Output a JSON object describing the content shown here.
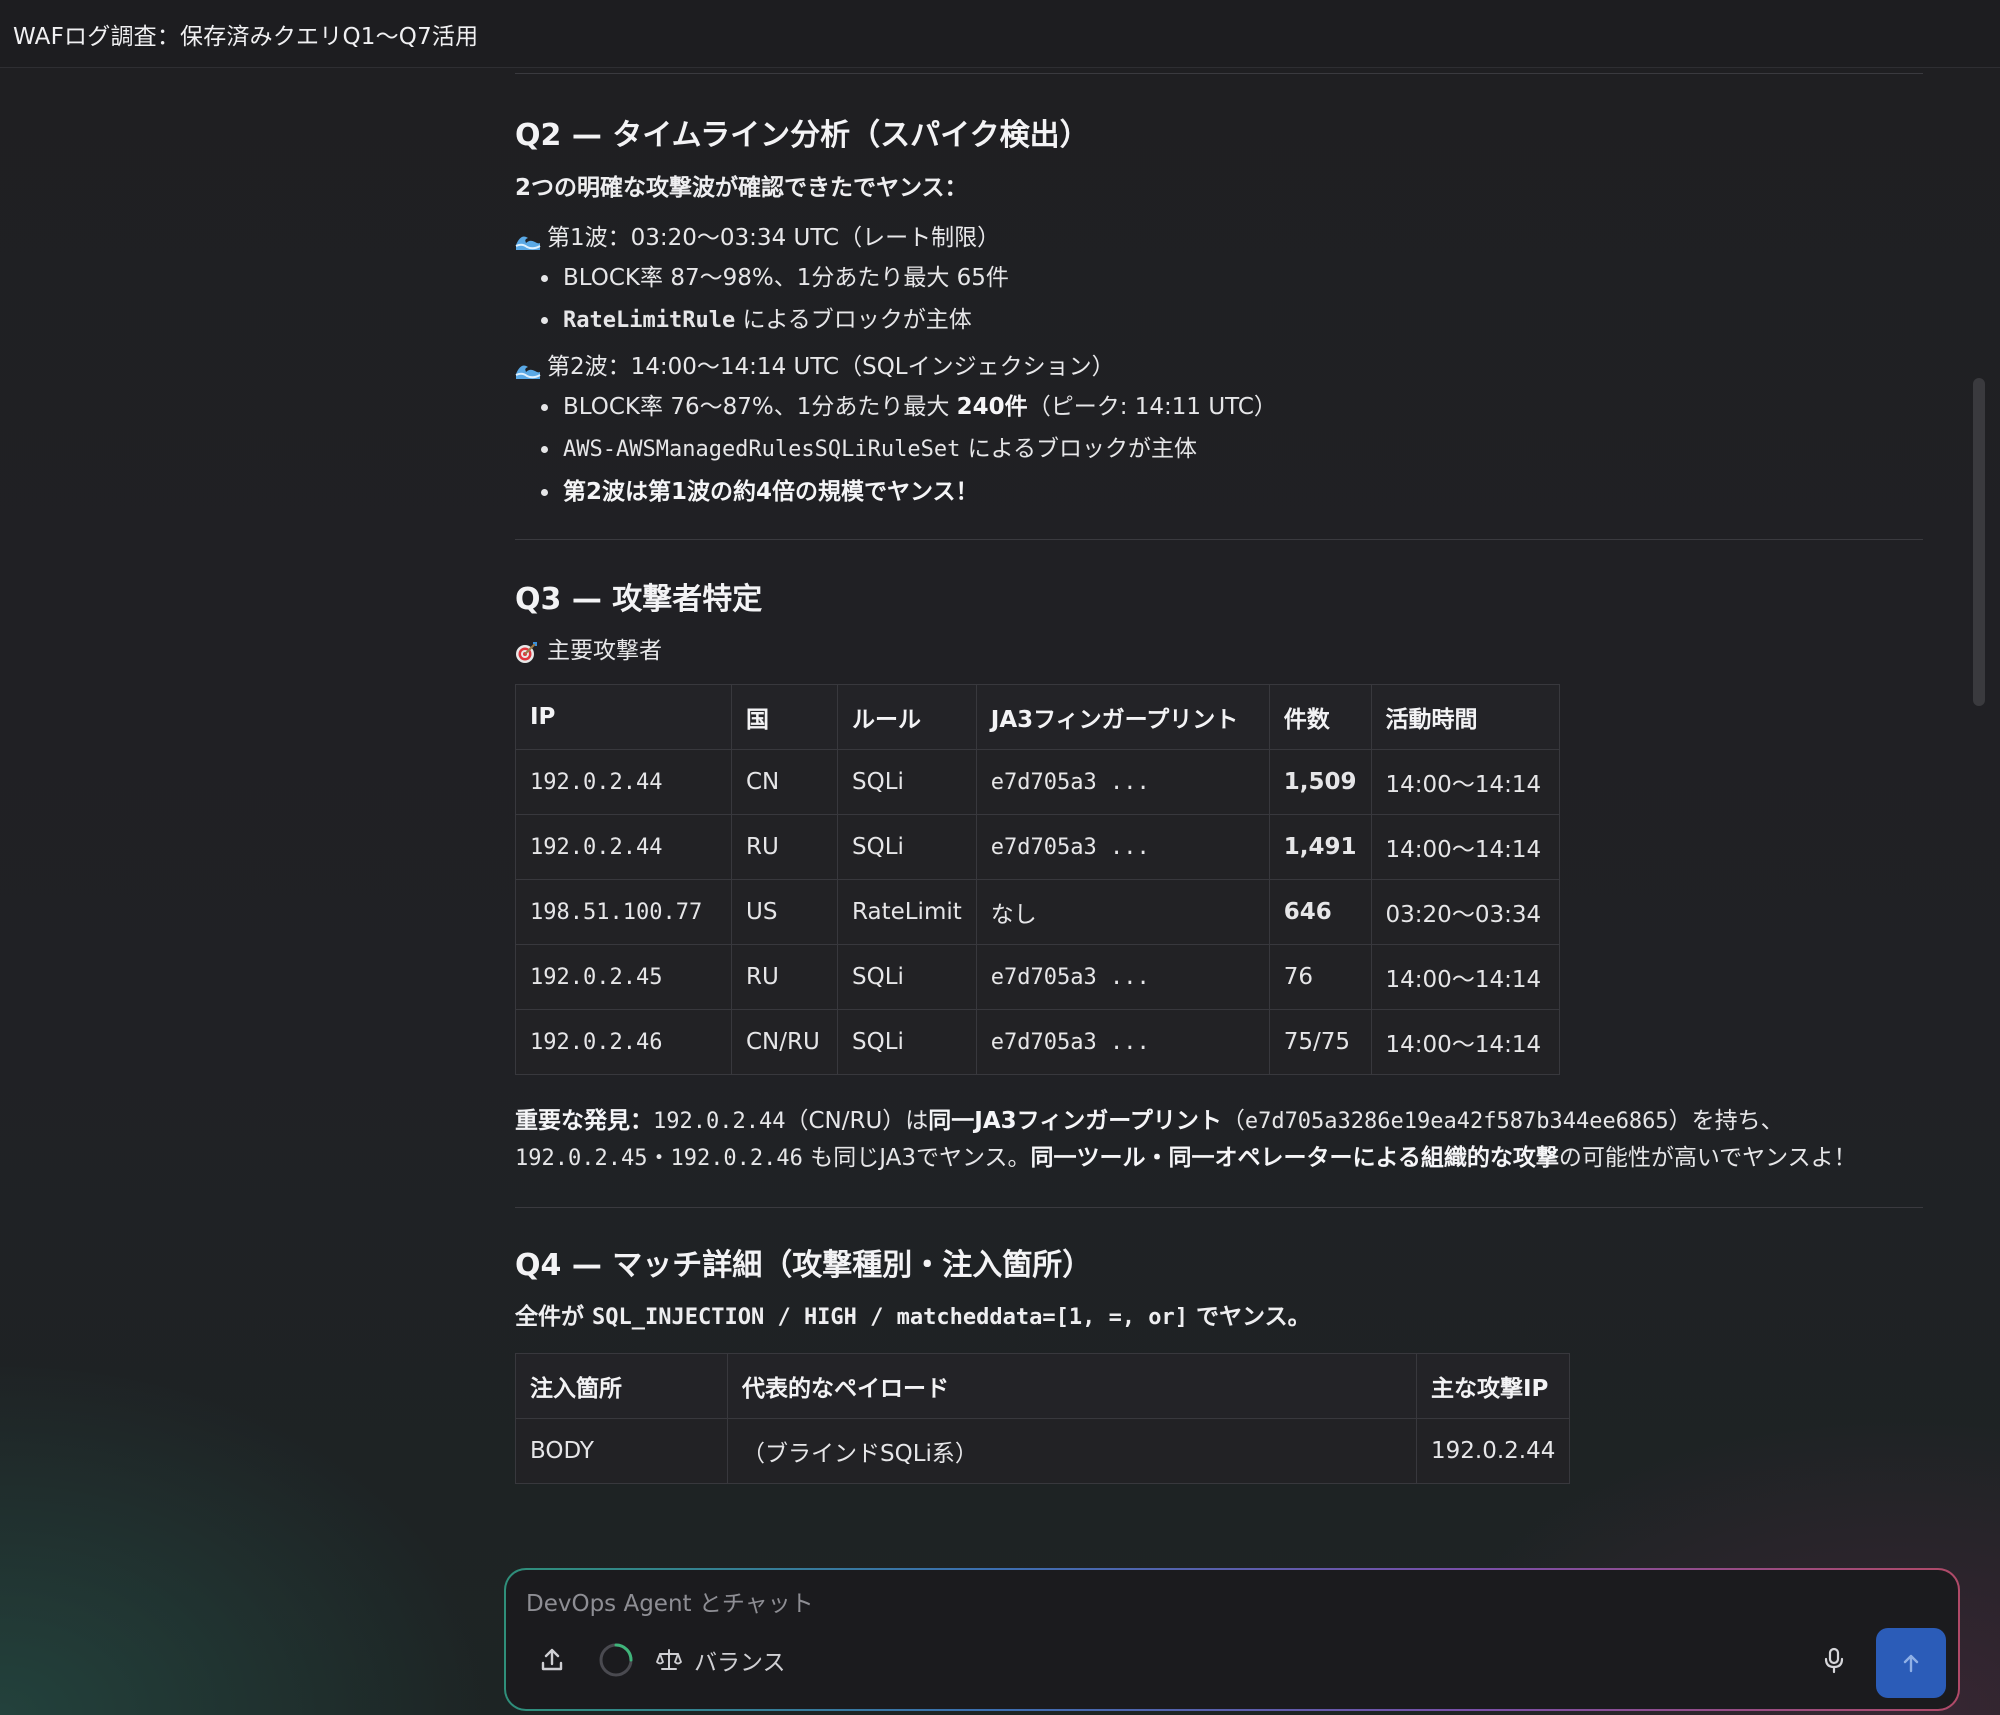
{
  "window": {
    "title": "WAFログ調査：保存済みクエリQ1〜Q7活用"
  },
  "q2": {
    "heading": "Q2 — タイムライン分析（スパイク検出）",
    "lead": "2つの明確な攻撃波が確認できたでヤンス：",
    "wave1": {
      "icon": "wave-icon",
      "title": "第1波：03:20〜03:34 UTC（レート制限）",
      "b1": "BLOCK率 87〜98%、1分あたり最大 65件",
      "b2_code": "RateLimitRule",
      "b2_text": " によるブロックが主体"
    },
    "wave2": {
      "icon": "wave-icon",
      "title": "第2波：14:00〜14:14 UTC（SQLインジェクション）",
      "b1_pre": "BLOCK率 76〜87%、1分あたり最大 ",
      "b1_bold": "240件",
      "b1_post": "（ピーク: 14:11 UTC）",
      "b2_code": "AWS-AWSManagedRulesSQLiRuleSet",
      "b2_text": " によるブロックが主体",
      "b3": "第2波は第1波の約4倍の規模でヤンス！"
    }
  },
  "q3": {
    "heading": "Q3 — 攻撃者特定",
    "sub_icon": "target-icon",
    "sub": "主要攻撃者",
    "table": {
      "headers": [
        "IP",
        "国",
        "ルール",
        "JA3フィンガープリント",
        "件数",
        "活動時間"
      ],
      "rows": [
        [
          "192.0.2.44",
          "CN",
          "SQLi",
          "e7d705a3 ...",
          "1,509",
          "14:00〜14:14"
        ],
        [
          "192.0.2.44",
          "RU",
          "SQLi",
          "e7d705a3 ...",
          "1,491",
          "14:00〜14:14"
        ],
        [
          "198.51.100.77",
          "US",
          "RateLimit",
          "なし",
          "646",
          "03:20〜03:34"
        ],
        [
          "192.0.2.45",
          "RU",
          "SQLi",
          "e7d705a3 ...",
          "76",
          "14:00〜14:14"
        ],
        [
          "192.0.2.46",
          "CN/RU",
          "SQLi",
          "e7d705a3 ...",
          "75/75",
          "14:00〜14:14"
        ]
      ]
    },
    "finding": {
      "label": "重要な発見：",
      "ip1": "192.0.2.44",
      "t1": "（CN/RU）は",
      "b1": "同一JA3フィンガープリント",
      "t2": "（",
      "ja3": "e7d705a3286e19ea42f587b344ee6865",
      "t3": "）を持ち、",
      "ip2": "192.0.2.45",
      "t4": "・",
      "ip3": "192.0.2.46",
      "t5": " も同じJA3でヤンス。",
      "b2": "同一ツール・同一オペレーターによる組織的な攻撃",
      "t6": "の可能性が高いでヤンスよ！"
    }
  },
  "q4": {
    "heading": "Q4 — マッチ詳細（攻撃種別・注入箇所）",
    "lead_pre": "全件が ",
    "lead_code": "SQL_INJECTION / HIGH / matcheddata=[1, =, or]",
    "lead_post": " でヤンス。",
    "table": {
      "headers": [
        "注入箇所",
        "代表的なペイロード",
        "主な攻撃IP"
      ],
      "rows": [
        [
          "BODY",
          "（ブラインドSQLi系）",
          "192.0.2.44"
        ]
      ]
    }
  },
  "chat": {
    "placeholder": "DevOps Agent とチャット",
    "mode_label": "バランス",
    "icons": [
      "upload-icon",
      "spinner-icon",
      "scale-icon",
      "mic-icon",
      "arrow-up-icon"
    ]
  }
}
